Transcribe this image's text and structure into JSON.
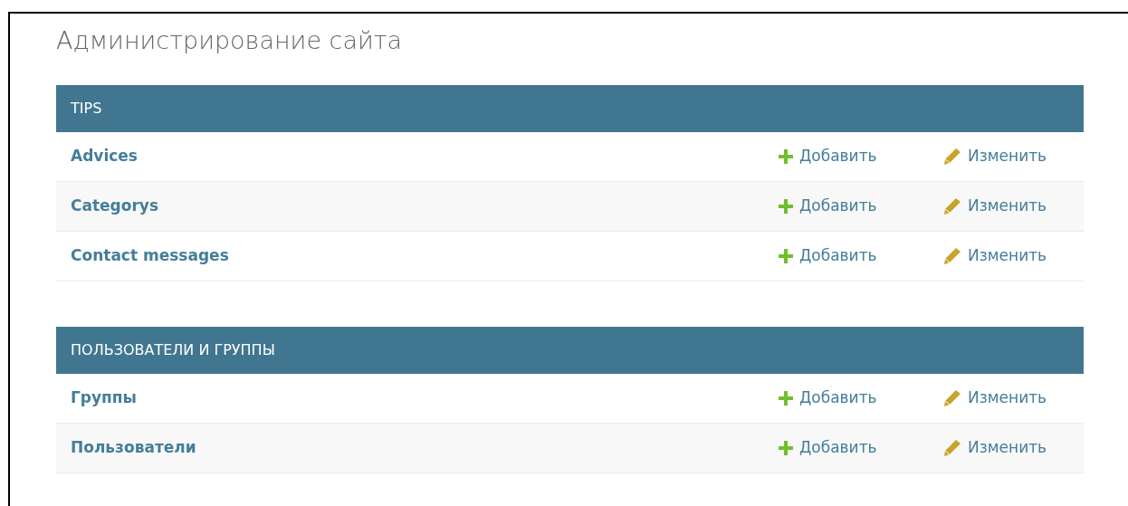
{
  "title": "Администрирование сайта",
  "modules": [
    {
      "caption": "TIPS",
      "models": [
        {
          "name": "Advices",
          "add": "Добавить",
          "change": "Изменить"
        },
        {
          "name": "Categorys",
          "add": "Добавить",
          "change": "Изменить"
        },
        {
          "name": "Contact messages",
          "add": "Добавить",
          "change": "Изменить"
        }
      ]
    },
    {
      "caption": "ПОЛЬЗОВАТЕЛИ И ГРУППЫ",
      "models": [
        {
          "name": "Группы",
          "add": "Добавить",
          "change": "Изменить"
        },
        {
          "name": "Пользователи",
          "add": "Добавить",
          "change": "Изменить"
        }
      ]
    }
  ]
}
